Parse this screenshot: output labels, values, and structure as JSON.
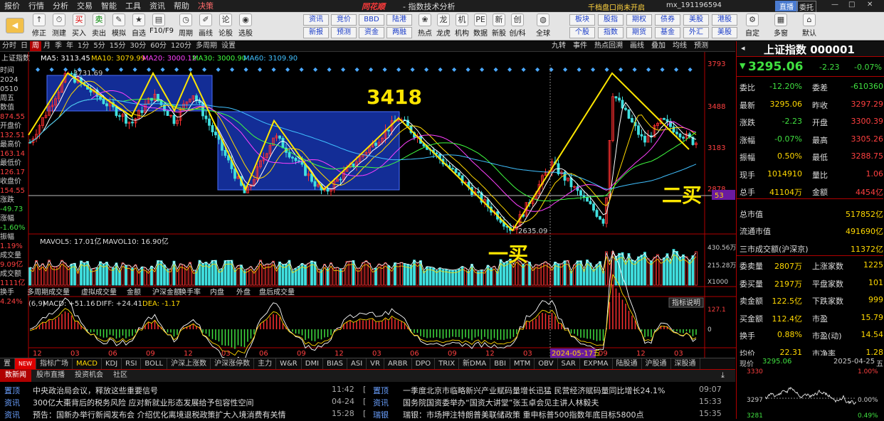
{
  "app": {
    "logo": "同花顺",
    "window_title": "- 指数技术分析",
    "promo_text": "千档盘口尚未开启",
    "account": "mx_191196594",
    "live_button": "直播",
    "agent_button": "委托",
    "window_min": "—",
    "window_max": "□",
    "window_close": "✕"
  },
  "menu": [
    "报价",
    "行情",
    "分析",
    "交易",
    "智能",
    "工具",
    "资讯",
    "帮助",
    "决策"
  ],
  "toolbar": {
    "nav_back_label": "",
    "buttons": [
      {
        "name": "fav",
        "label": "修正",
        "icon": "↑"
      },
      {
        "name": "test",
        "label": "测建",
        "icon": "⏱"
      },
      {
        "name": "buy",
        "label": "买入",
        "icon": "买"
      },
      {
        "name": "sell",
        "label": "卖出",
        "icon": "卖"
      },
      {
        "name": "sim",
        "label": "模拟",
        "icon": "✎"
      },
      {
        "name": "self",
        "label": "自选",
        "icon": "★"
      },
      {
        "name": "f10",
        "label": "F10/F9",
        "icon": "▤"
      },
      {
        "name": "period",
        "label": "周期",
        "icon": "◷"
      },
      {
        "name": "draw",
        "label": "画线",
        "icon": "✐"
      },
      {
        "name": "theory",
        "label": "论股",
        "icon": "论"
      },
      {
        "name": "select",
        "label": "选股",
        "icon": "◉"
      }
    ],
    "grid_row1": [
      "资讯",
      "竞价",
      "BBD",
      "陆港"
    ],
    "grid_row2": [
      "新报",
      "预测",
      "资金",
      "两融"
    ],
    "mid_buttons": [
      {
        "name": "hot",
        "label": "热点",
        "icon": "❀"
      },
      {
        "name": "dragon",
        "label": "龙虎",
        "icon": "龙"
      },
      {
        "name": "org",
        "label": "机构",
        "icon": "机"
      },
      {
        "name": "data",
        "label": "数据",
        "icon": "PE"
      },
      {
        "name": "newstock",
        "label": "新股",
        "icon": "新"
      },
      {
        "name": "chuang",
        "label": "创/科",
        "icon": "创"
      },
      {
        "name": "global",
        "label": "全球",
        "icon": "◍"
      }
    ],
    "grid2_row1": [
      "板块",
      "股指",
      "期权",
      "债券",
      "美股",
      "港股"
    ],
    "grid2_row2": [
      "个股",
      "指数",
      "期货",
      "基金",
      "外汇",
      "美股"
    ],
    "right_buttons": [
      {
        "name": "custom",
        "label": "自定",
        "icon": "⚙"
      },
      {
        "name": "multi",
        "label": "多窗",
        "icon": "▦"
      },
      {
        "name": "default",
        "label": "默认",
        "icon": "⌂"
      }
    ]
  },
  "period_tabs": [
    "分时",
    "日",
    "周",
    "月",
    "季",
    "年",
    "1分",
    "5分",
    "15分",
    "30分",
    "60分",
    "120分",
    "多周期",
    "设置"
  ],
  "active_period": "周",
  "chart_tools": [
    "九转",
    "事件",
    "热点回溯",
    "画线",
    "叠加",
    "均线",
    "预测"
  ],
  "indicator_line": {
    "index_name": "上证指数",
    "ma5": "MA5: 3113.45",
    "ma10": "MA10: 3079.99",
    "ma20": "MA20: 3000.12",
    "ma30": "MA30: 3000.90",
    "ma60": "MA60: 3109.90"
  },
  "colors": {
    "ma5": "#ffffff",
    "ma10": "#ffd800",
    "ma20": "#ff40ff",
    "ma30": "#40ff40",
    "ma60": "#40c0ff",
    "up": "#ff3030",
    "down": "#40e0e0",
    "annotation": "#ffe600",
    "box": "#1a3cc8"
  },
  "left_info": [
    "时间",
    "2024",
    "0510",
    "周五",
    "数值",
    "874.55",
    "开盘价",
    "132.51",
    "最高价",
    "163.14",
    "最低价",
    "126.17",
    "收盘价",
    "154.55",
    "涨跌",
    "-49.73",
    "涨幅",
    "-1.60%",
    "振幅",
    "1.19%",
    "成交量",
    "9.09亿",
    "成交额",
    "1111亿",
    "换手",
    "4.24%"
  ],
  "chart_labels": {
    "high_label": "3731.69",
    "low_label": "2635.09",
    "price_ticks": [
      "3793",
      "3488",
      "3183",
      "2878"
    ],
    "price_marker": "53",
    "vol_ticks": [
      "430.56万",
      "215.28万",
      "X1000"
    ],
    "macd_ticks": [
      "127.1",
      "0"
    ],
    "mavol": "MAVOL5: 17.01亿",
    "mavol10": "MAVOL10: 16.90亿",
    "macd": "MACD: +51.16",
    "diff": "DIFF: +24.41",
    "dea": "DEA: -1.17",
    "macd_prefix": "(6,9)",
    "indicator_help": "指标说明",
    "date_cursor": "2024-05-17五",
    "x_ticks": [
      "12",
      "03",
      "06",
      "09",
      "12",
      "03",
      "06",
      "09",
      "12",
      "03",
      "06",
      "09",
      "12",
      "03",
      "06",
      "09",
      "12",
      "03"
    ]
  },
  "vol_tabs": [
    "多周期成交量",
    "虚拟成交量",
    "金额",
    "沪深金额",
    "换手率",
    "内盘",
    "外盘",
    "盘后成交量"
  ],
  "annotations": {
    "level": "3418",
    "first_buy": "一买",
    "second_buy": "二买"
  },
  "chart_data": {
    "type": "candlestick",
    "title": "上证指数 周K线",
    "ylim": [
      2630,
      3800
    ],
    "swing_points": [
      {
        "label": "H1",
        "value": 3731.69
      },
      {
        "label": "L1",
        "value": 2635.09
      },
      {
        "label": "level",
        "value": 3418
      }
    ]
  },
  "right_panel": {
    "title": "上证指数 000001",
    "price": "3295.06",
    "change": "-2.23",
    "pct": "-0.07%",
    "rows": [
      [
        "委比",
        "-12.20%",
        "委差",
        "-610360"
      ],
      [
        "最新",
        "3295.06",
        "昨收",
        "3297.29"
      ],
      [
        "涨跌",
        "-2.23",
        "开盘",
        "3300.39"
      ],
      [
        "涨幅",
        "-0.07%",
        "最高",
        "3305.26"
      ],
      [
        "振幅",
        "0.50%",
        "最低",
        "3288.75"
      ],
      [
        "现手",
        "1014910",
        "量比",
        "1.06"
      ],
      [
        "总手",
        "41104万",
        "金额",
        "4454亿"
      ],
      [
        "总市值",
        "",
        "",
        "517852亿"
      ],
      [
        "流通市值",
        "",
        "",
        "491690亿"
      ],
      [
        "三市成交额(沪深京)",
        "",
        "",
        "11372亿"
      ],
      [
        "委卖量",
        "2807万",
        "上涨家数",
        "1225"
      ],
      [
        "委买量",
        "2197万",
        "平盘家数",
        "101"
      ],
      [
        "卖金额",
        "122.5亿",
        "下跌家数",
        "999"
      ],
      [
        "买金额",
        "112.4亿",
        "市盈",
        "15.79"
      ],
      [
        "换手",
        "0.88%",
        "市盈(动)",
        "14.54"
      ],
      [
        "均价",
        "22.31",
        "市净率",
        "1.28"
      ]
    ]
  },
  "bottom_tabs": [
    "置",
    "NEW",
    "指标广场",
    "MACD",
    "KDJ",
    "RSI",
    "BOLL",
    "沪深上涨数",
    "沪深涨停数",
    "主力",
    "W&R",
    "DMI",
    "BIAS",
    "ASI",
    "VR",
    "ARBR",
    "DPO",
    "TRIX",
    "新DMA",
    "BBI",
    "MTM",
    "OBV",
    "SAR",
    "EXPMA",
    "陆股通",
    "沪股通",
    "深股通"
  ],
  "news_tabs": [
    "数新闻",
    "股市直播",
    "投资机会",
    "社区"
  ],
  "news": [
    {
      "cat": "置顶",
      "title": "中央政治局会议，释放这些重要信号",
      "time": "11:42"
    },
    {
      "cat": "资讯",
      "title": "300亿大棗背后的税务风险 应对新就业形态发展给予包容性空间",
      "time": "04-24"
    },
    {
      "cat": "资讯",
      "title": "预告：国新办举行新闻发布会 介绍优化离境退税政策扩大入境消费有关情",
      "time": "15:28"
    },
    {
      "cat": "置顶",
      "title": "一季度北京市临略新兴产业赋码量增长迅猛 民营经济赋码量同比增长24.1%",
      "time": "09:07"
    },
    {
      "cat": "资讯",
      "title": "国务院国资委举办“国资大讲堂”张玉卓会见主讲人林毅夫",
      "time": "15:33"
    },
    {
      "cat": "瑞银",
      "title": "瑞银：市场押注特朗普美联储政策 重申标普500指数年底目标5800点",
      "time": "15:35"
    }
  ],
  "mini_chart": {
    "label": "现价",
    "price": "3295.06",
    "date": "2025-04-25",
    "day": "五",
    "y_ticks": [
      "3330",
      "3297",
      "3281"
    ],
    "pct_ticks": [
      "1.00%",
      "0.00%",
      "0.49%"
    ]
  }
}
